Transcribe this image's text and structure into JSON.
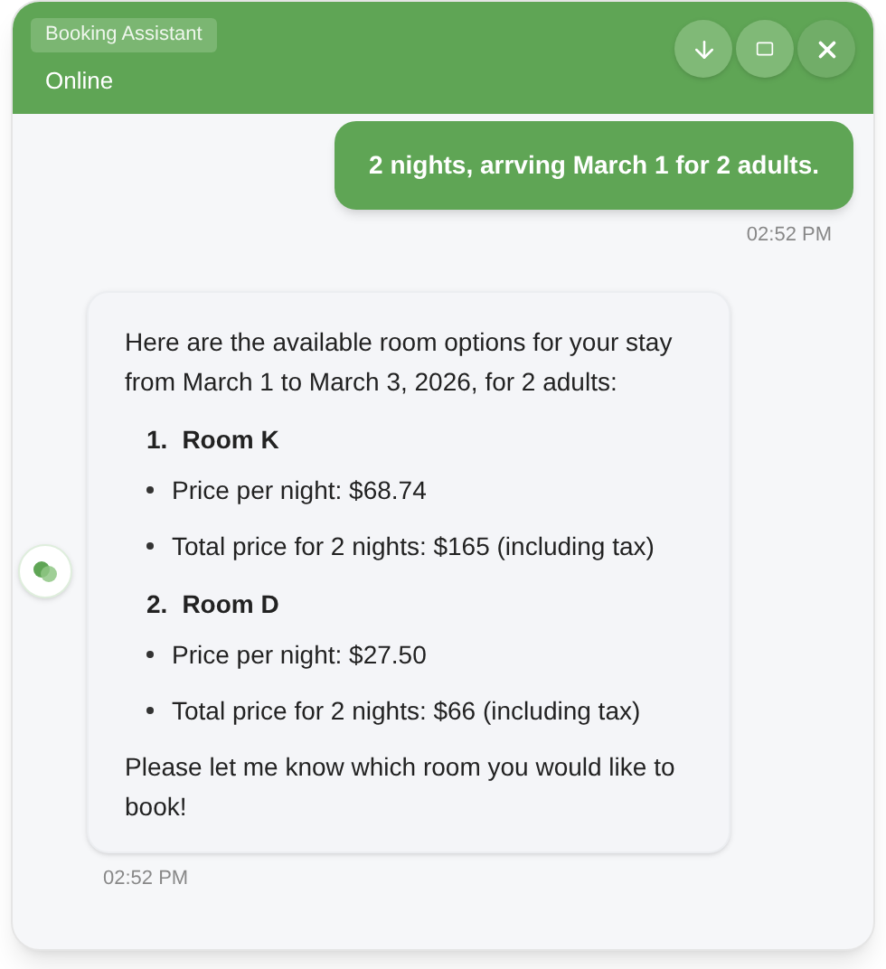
{
  "header": {
    "title": "Booking Assistant",
    "status": "Online"
  },
  "messages": [
    {
      "kind": "user",
      "text": "2 nights, arrving March 1 for 2 adults.",
      "time": "02:52 PM"
    },
    {
      "kind": "bot",
      "intro": "Here are the available room options for your stay from March 1 to March 3, 2026, for 2 adults:",
      "rooms": [
        {
          "number": "1.",
          "name": "Room K",
          "details": [
            "Price per night: $68.74",
            "Total price for 2 nights: $165 (including tax)"
          ]
        },
        {
          "number": "2.",
          "name": "Room D",
          "details": [
            "Price per night: $27.50",
            "Total price for 2 nights: $66 (including tax)"
          ]
        }
      ],
      "outro": "Please let me know which room you would like to book!",
      "time": "02:52 PM"
    }
  ]
}
